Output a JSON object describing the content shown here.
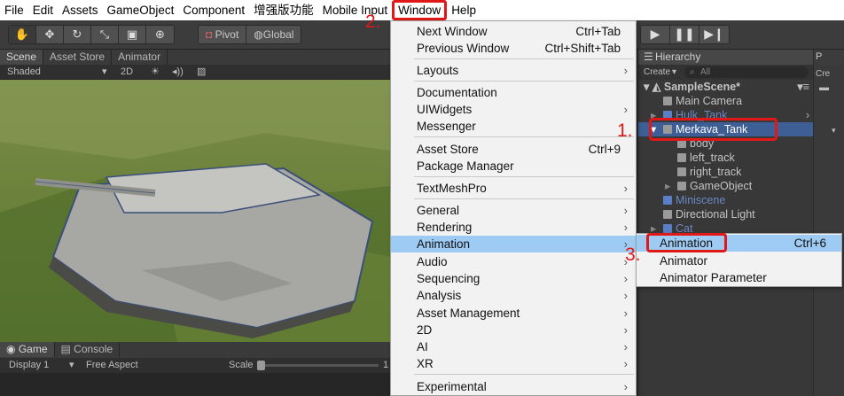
{
  "menubar": {
    "items": [
      "File",
      "Edit",
      "Assets",
      "GameObject",
      "Component",
      "增强版功能",
      "Mobile Input",
      "Window",
      "Help"
    ],
    "active_index": 7
  },
  "toolbar": {
    "tools": [
      "hand-icon",
      "move-icon",
      "rotate-icon",
      "scale-icon",
      "rect-icon",
      "transform-icon"
    ],
    "pivot_label": "Pivot",
    "global_label": "Global"
  },
  "scene": {
    "tabs": [
      "Scene",
      "Asset Store",
      "Animator"
    ],
    "shading": "Shaded",
    "mode_2d": "2D"
  },
  "game": {
    "tabs": [
      "Game",
      "Console"
    ],
    "display": "Display 1",
    "aspect": "Free Aspect",
    "scale_label": "Scale",
    "scale_value": "1"
  },
  "hierarchy": {
    "tab": "Hierarchy",
    "create": "Create",
    "search_placeholder": "All",
    "scene_name": "SampleScene*",
    "rows": [
      {
        "label": "Main Camera",
        "indent": 1,
        "state": "normal"
      },
      {
        "label": "Hulk_Tank",
        "indent": 1,
        "state": "dim"
      },
      {
        "label": "Merkava_Tank",
        "indent": 1,
        "state": "selected"
      },
      {
        "label": "body",
        "indent": 2,
        "state": "normal"
      },
      {
        "label": "left_track",
        "indent": 2,
        "state": "normal"
      },
      {
        "label": "right_track",
        "indent": 2,
        "state": "normal"
      },
      {
        "label": "GameObject",
        "indent": 2,
        "state": "normal"
      },
      {
        "label": "Miniscene",
        "indent": 1,
        "state": "dim"
      },
      {
        "label": "Directional Light",
        "indent": 1,
        "state": "normal"
      },
      {
        "label": "Cat",
        "indent": 1,
        "state": "dim"
      }
    ]
  },
  "project": {
    "tab": "P",
    "create": "Cre"
  },
  "window_menu": {
    "items": [
      {
        "label": "Next Window",
        "shortcut": "Ctrl+Tab"
      },
      {
        "label": "Previous Window",
        "shortcut": "Ctrl+Shift+Tab"
      },
      {
        "label": "Layouts",
        "submenu": true
      },
      {
        "label": "Documentation"
      },
      {
        "label": "UIWidgets",
        "submenu": true
      },
      {
        "label": "Messenger"
      },
      {
        "label": "Asset Store",
        "shortcut": "Ctrl+9"
      },
      {
        "label": "Package Manager"
      },
      {
        "label": "TextMeshPro",
        "submenu": true
      },
      {
        "label": "General",
        "submenu": true
      },
      {
        "label": "Rendering",
        "submenu": true
      },
      {
        "label": "Animation",
        "submenu": true,
        "highlighted": true
      },
      {
        "label": "Audio",
        "submenu": true
      },
      {
        "label": "Sequencing",
        "submenu": true
      },
      {
        "label": "Analysis",
        "submenu": true
      },
      {
        "label": "Asset Management",
        "submenu": true
      },
      {
        "label": "2D",
        "submenu": true
      },
      {
        "label": "AI",
        "submenu": true
      },
      {
        "label": "XR",
        "submenu": true
      },
      {
        "label": "Experimental",
        "submenu": true
      }
    ],
    "arrow_glyph": "›"
  },
  "animation_submenu": {
    "items": [
      {
        "label": "Animation",
        "shortcut": "Ctrl+6",
        "highlighted": true
      },
      {
        "label": "Animator"
      },
      {
        "label": "Animator Parameter"
      }
    ]
  },
  "annotations": {
    "step1": "1.",
    "step2": "2.",
    "step3": "3.",
    "color": "#e01818"
  },
  "colors": {
    "menu_highlight": "#9ecbf3",
    "selection": "#3e5f96"
  }
}
